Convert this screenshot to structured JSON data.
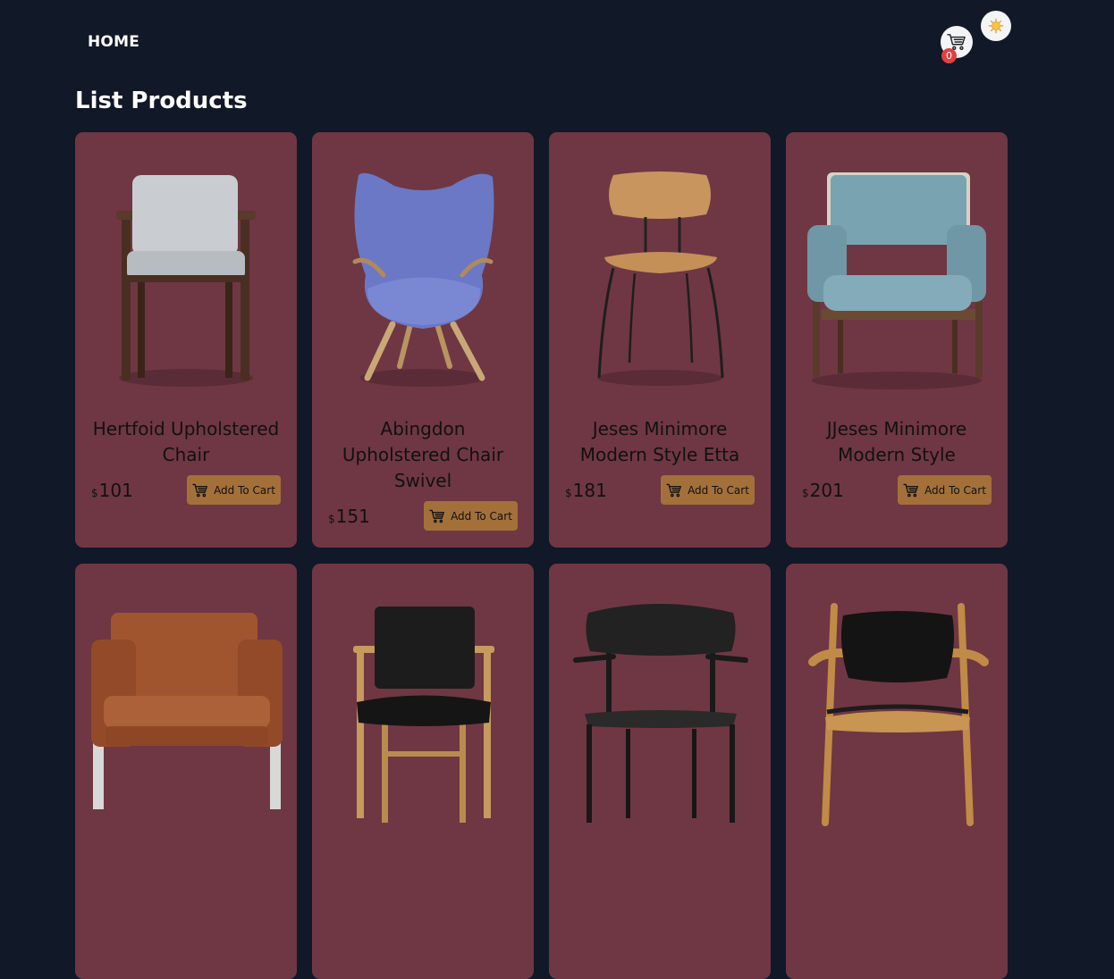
{
  "nav": {
    "home_label": "HOME"
  },
  "cart": {
    "count": "0",
    "icon": "cart-icon"
  },
  "theme": {
    "icon": "sun-icon"
  },
  "page": {
    "title": "List Products"
  },
  "colors": {
    "background": "#111827",
    "card": "#6f3743",
    "button": "#a4703a",
    "badge": "#e53e3e"
  },
  "products": [
    {
      "name": "Hertfoid Upholstered Chair",
      "currency": "$",
      "price": "101",
      "button_label": "Add To Cart"
    },
    {
      "name": "Abingdon Upholstered Chair Swivel",
      "currency": "$",
      "price": "151",
      "button_label": "Add To Cart"
    },
    {
      "name": "Jeses Minimore Modern Style Etta",
      "currency": "$",
      "price": "181",
      "button_label": "Add To Cart"
    },
    {
      "name": "JJeses Minimore Modern Style",
      "currency": "$",
      "price": "201",
      "button_label": "Add To Cart"
    }
  ]
}
